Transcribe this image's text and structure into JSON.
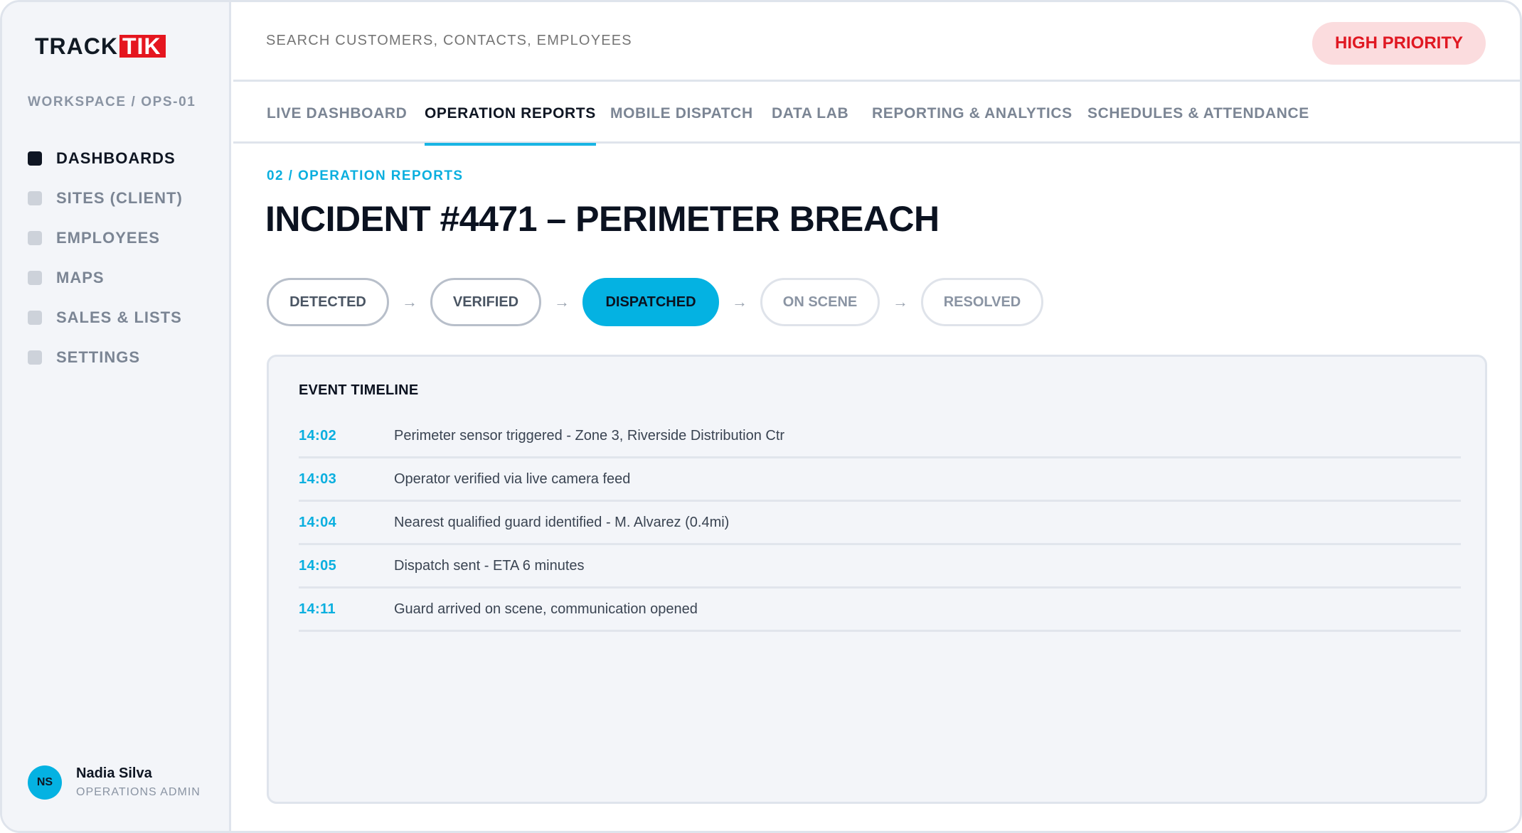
{
  "brand": {
    "track": "TRACK",
    "tik": "TIK",
    "accent_color": "#e5161f"
  },
  "sidebar": {
    "workspace": "WORKSPACE / OPS-01",
    "items": [
      {
        "label": "DASHBOARDS",
        "active": true
      },
      {
        "label": "SITES (CLIENT)",
        "active": false
      },
      {
        "label": "EMPLOYEES",
        "active": false
      },
      {
        "label": "MAPS",
        "active": false
      },
      {
        "label": "SALES & LISTS",
        "active": false
      },
      {
        "label": "SETTINGS",
        "active": false
      }
    ],
    "user": {
      "initials": "NS",
      "name": "Nadia Silva",
      "role": "OPERATIONS ADMIN"
    }
  },
  "header": {
    "search_placeholder": "SEARCH CUSTOMERS, CONTACTS, EMPLOYEES",
    "priority_badge": "HIGH PRIORITY"
  },
  "tabs": [
    {
      "label": "LIVE DASHBOARD",
      "active": false
    },
    {
      "label": "OPERATION REPORTS",
      "active": true
    },
    {
      "label": "MOBILE DISPATCH",
      "active": false
    },
    {
      "label": "DATA LAB",
      "active": false
    },
    {
      "label": "REPORTING & ANALYTICS",
      "active": false
    },
    {
      "label": "SCHEDULES & ATTENDANCE",
      "active": false
    }
  ],
  "main": {
    "breadcrumb": "02 / OPERATION REPORTS",
    "title": "INCIDENT #4471 – PERIMETER BREACH",
    "steps": [
      {
        "label": "DETECTED",
        "state": "done"
      },
      {
        "label": "VERIFIED",
        "state": "done"
      },
      {
        "label": "DISPATCHED",
        "state": "current"
      },
      {
        "label": "ON SCENE",
        "state": "pending"
      },
      {
        "label": "RESOLVED",
        "state": "pending"
      }
    ],
    "timeline": {
      "title": "EVENT TIMELINE",
      "events": [
        {
          "time": "14:02",
          "text": "Perimeter sensor triggered - Zone 3, Riverside Distribution Ctr"
        },
        {
          "time": "14:03",
          "text": "Operator verified via live camera feed"
        },
        {
          "time": "14:04",
          "text": "Nearest qualified guard identified - M. Alvarez (0.4mi)"
        },
        {
          "time": "14:05",
          "text": "Dispatch sent - ETA 6 minutes"
        },
        {
          "time": "14:11",
          "text": "Guard arrived on scene, communication opened"
        }
      ]
    }
  },
  "colors": {
    "accent": "#04b2e2",
    "priority_text": "#e01822",
    "priority_bg": "#fbdcde"
  }
}
